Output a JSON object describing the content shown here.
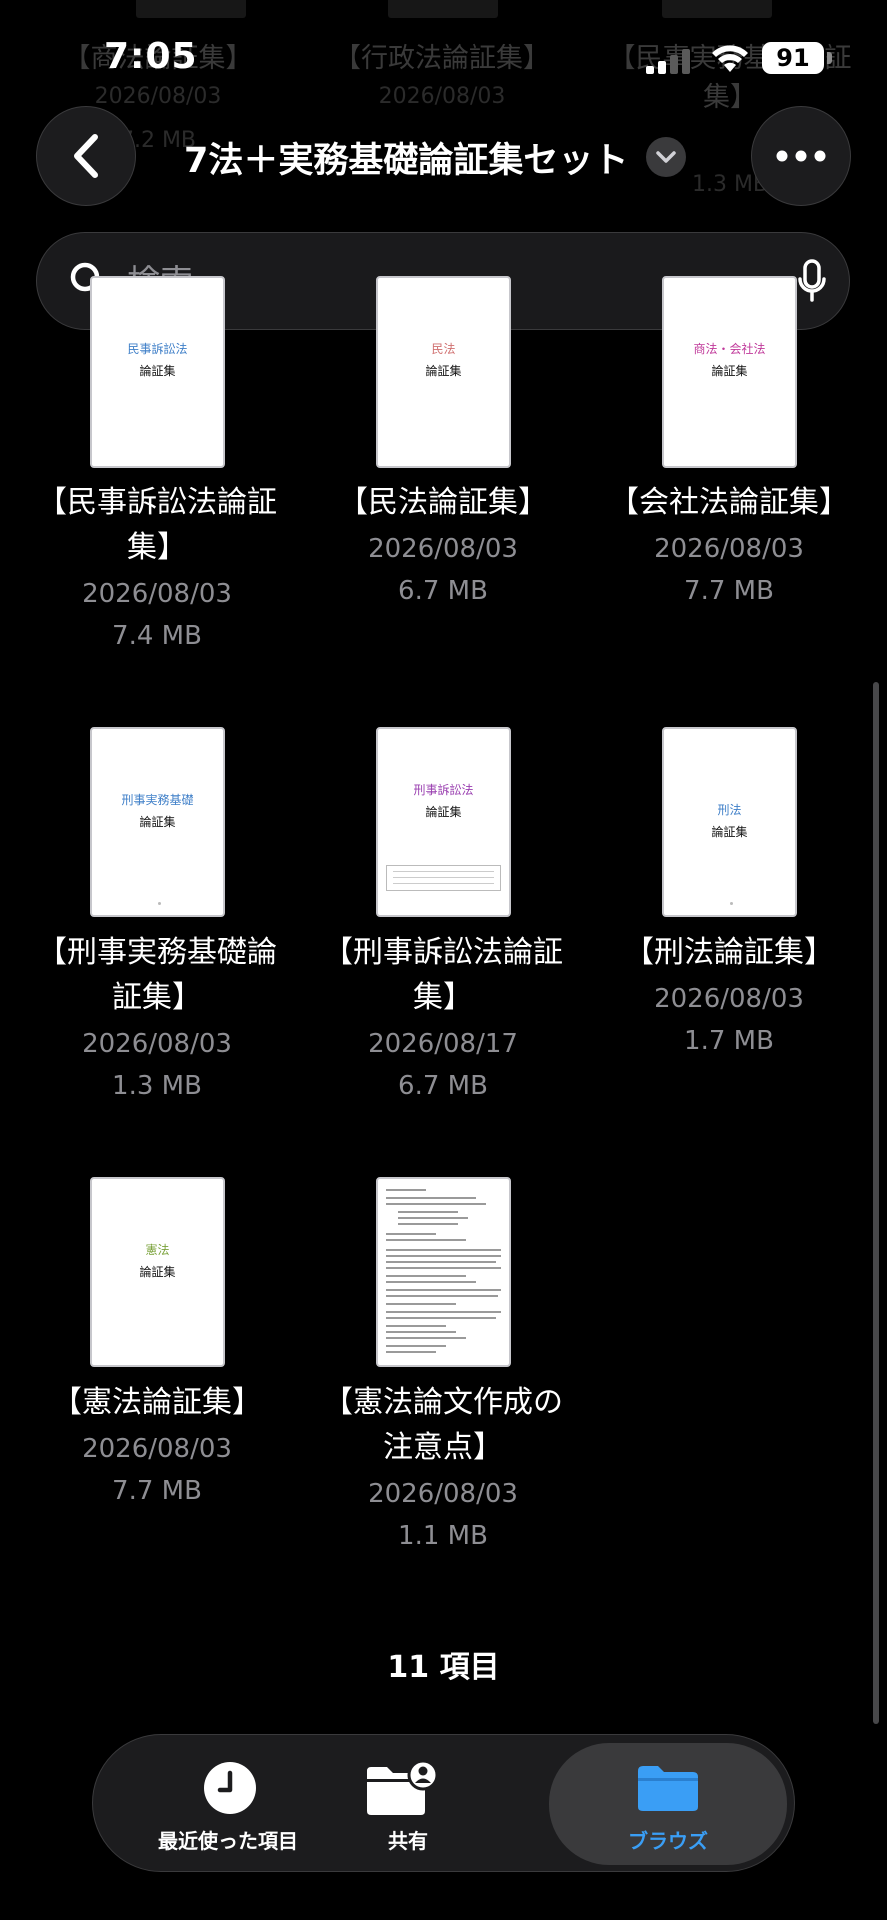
{
  "status": {
    "time": "7:05",
    "battery": "91"
  },
  "header": {
    "title": "7法＋実務基礎論証集セット"
  },
  "search": {
    "placeholder": "検索"
  },
  "ghost": {
    "items": [
      {
        "name": "【商法論証集】",
        "date": "2026/08/03",
        "size": "7.2 MB"
      },
      {
        "name": "【行政法論証集】",
        "date": "2026/08/03",
        "size": ""
      },
      {
        "name": "【民事実務基礎論証集】",
        "date": "",
        "size": "1.3 MB"
      }
    ]
  },
  "files": [
    {
      "thumb_sub": "民事訴訟法",
      "thumb_main": "論証集",
      "thumb_color": "#3f7fc8",
      "name_line1": "【民事訴訟法論証",
      "name_line2": "集】",
      "date": "2026/08/03",
      "size": "7.4 MB"
    },
    {
      "thumb_sub": "民法",
      "thumb_main": "論証集",
      "thumb_color": "#d07070",
      "name_line1": "【民法論証集】",
      "name_line2": "",
      "date": "2026/08/03",
      "size": "6.7 MB"
    },
    {
      "thumb_sub": "商法・会社法",
      "thumb_main": "論証集",
      "thumb_color": "#c0399a",
      "name_line1": "【会社法論証集】",
      "name_line2": "",
      "date": "2026/08/03",
      "size": "7.7 MB"
    },
    {
      "thumb_sub": "刑事実務基礎",
      "thumb_main": "論証集",
      "thumb_color": "#3f7fc8",
      "name_line1": "【刑事実務基礎論",
      "name_line2": "証集】",
      "date": "2026/08/03",
      "size": "1.3 MB"
    },
    {
      "thumb_sub": "刑事訴訟法",
      "thumb_main": "論証集",
      "thumb_color": "#9a3fb0",
      "name_line1": "【刑事訴訟法論証",
      "name_line2": "集】",
      "date": "2026/08/17",
      "size": "6.7 MB"
    },
    {
      "thumb_sub": "刑法",
      "thumb_main": "論証集",
      "thumb_color": "#3f7fc8",
      "name_line1": "【刑法論証集】",
      "name_line2": "",
      "date": "2026/08/03",
      "size": "1.7 MB"
    },
    {
      "thumb_sub": "憲法",
      "thumb_main": "論証集",
      "thumb_color": "#7aa23a",
      "name_line1": "【憲法論証集】",
      "name_line2": "",
      "date": "2026/08/03",
      "size": "7.7 MB"
    },
    {
      "thumb_sub": "",
      "thumb_main": "",
      "thumb_color": "#999999",
      "name_line1": "【憲法論文作成の",
      "name_line2": "注意点】",
      "date": "2026/08/03",
      "size": "1.1 MB"
    }
  ],
  "footer": {
    "count": "11 項目"
  },
  "tabs": [
    {
      "label": "最近使った項目",
      "icon": "clock-icon"
    },
    {
      "label": "共有",
      "icon": "shared-folder-icon"
    },
    {
      "label": "ブラウズ",
      "icon": "folder-icon"
    }
  ],
  "colors": {
    "accent": "#3a9ef5",
    "secondary_text": "#8e8e93"
  }
}
